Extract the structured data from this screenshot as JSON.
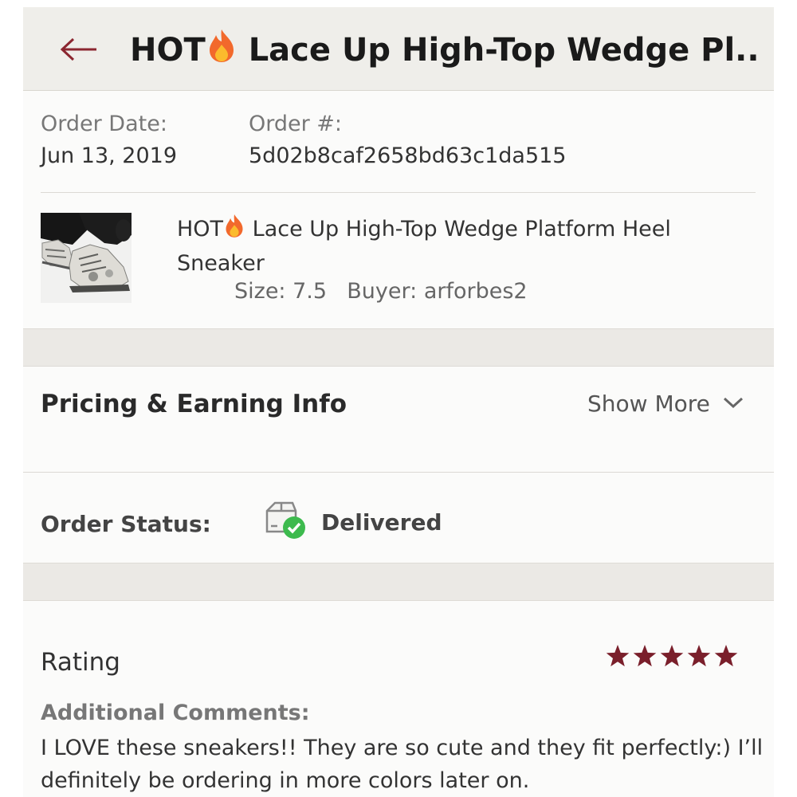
{
  "header": {
    "title_prefix": "HOT",
    "title_rest": " Lace Up High-Top Wedge Pl...",
    "back_icon": "arrow-left-icon",
    "flame_icon": "fire-emoji-icon"
  },
  "order": {
    "date_label": "Order Date:",
    "date_value": "Jun 13, 2019",
    "number_label": "Order #:",
    "number_value": "5d02b8caf2658bd63c1da515"
  },
  "item": {
    "name_prefix": "HOT",
    "name_rest": " Lace Up High-Top Wedge Platform Heel Sneaker",
    "size_label": "Size:",
    "size_value": "7.5",
    "buyer_label": "Buyer:",
    "buyer_value": "arforbes2",
    "thumbnail_icon": "product-photo-sneakers"
  },
  "pricing": {
    "title": "Pricing & Earning Info",
    "show_more_label": "Show More",
    "show_more_icon": "chevron-down-icon"
  },
  "status": {
    "label": "Order Status:",
    "value": "Delivered",
    "icon": "package-delivered-icon"
  },
  "rating": {
    "label": "Rating",
    "stars": 5,
    "max_stars": 5,
    "star_color": "#7a1f2b",
    "comments_label": "Additional Comments:",
    "comments": "I LOVE these sneakers!! They are so cute and they fit perfectly:) I’ll definitely be ordering in more colors later on."
  },
  "colors": {
    "accent": "#7a1f2b",
    "check_green": "#3dba4e"
  }
}
